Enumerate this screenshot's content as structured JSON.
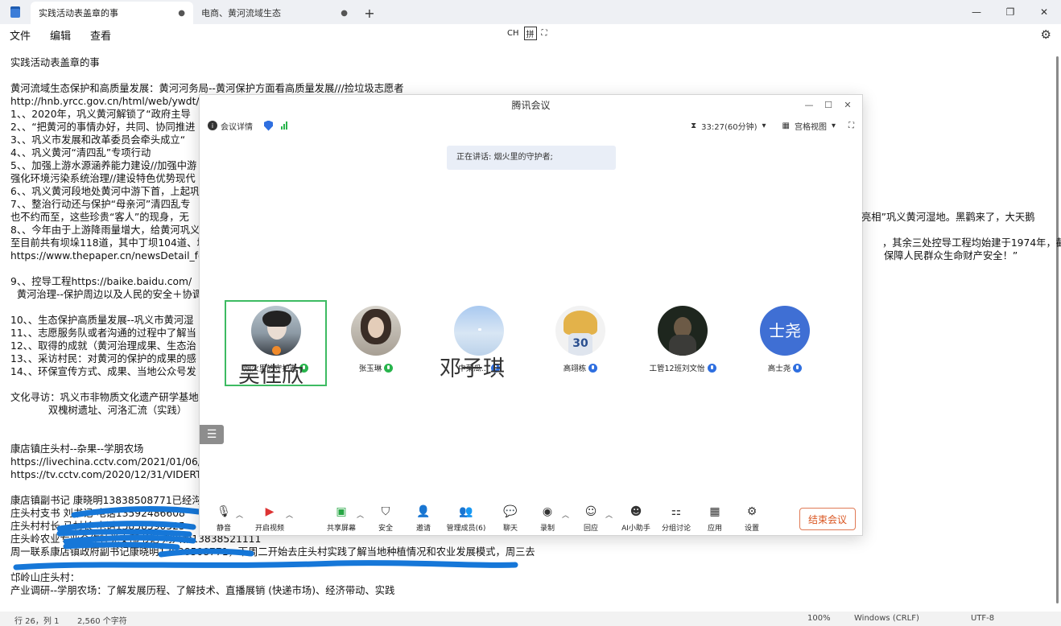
{
  "tabs": [
    {
      "label": "实践活动表盖章的事",
      "active": true
    },
    {
      "label": "电商、黄河流域生态",
      "active": false
    }
  ],
  "menu": [
    "文件",
    "编辑",
    "查看"
  ],
  "ime": {
    "ch": "CH",
    "pin": "拼"
  },
  "editor_lines": [
    "实践活动表盖章的事",
    "",
    "黄河流域生态保护和高质量发展：黄河河务局--黄河保护方面看高质量发展///捡垃圾志愿者",
    "http://hnb.yrcc.gov.cn/html/web/ywdt/",
    "1、、2020年，巩义黄河解锁了“政府主导",
    "2、、“把黄河的事情办好，共同、协同推进",
    "3、、巩义市发展和改革委员会牵头成立“",
    "4、、巩义黄河“清四乱”专项行动",
    "5、、加强上游水源涵养能力建设//加强中游",
    "强化环境污染系统治理//建设特色优势现代",
    "6、、巩义黄河段地处黄河中游下首，上起巩",
    "7、、整治行动还与保护“母亲河”清四乱专",
    "也不约而至，这些珍贵“客人”的现身，无",
    "8、、今年由于上游降雨量增大，给黄河巩义",
    "至目前共有坝垛118道，其中丁坝104道、垛",
    "https://www.thepaper.cn/newsDetail_fo",
    "",
    "9、、控导工程https://baike.baidu.com/",
    "  黄河治理--保护周边以及人民的安全＋协调",
    "",
    "10、、生态保护高质量发展--巩义市黄河湿",
    "11、、志愿服务队或者沟通的过程中了解当",
    "12、、取得的成就（黄河治理成果、生态治",
    "13、、采访村民：对黄河的保护的成果的感",
    "14、、环保宣传方式、成果、当地公众号发",
    "",
    "文化寻访：巩义市非物质文化遗产研学基地",
    "            双槐树遗址、河洛汇流（实践）",
    "",
    "",
    "康店镇庄头村--杂果--学朋农场",
    "https://livechina.cctv.com/2021/01/06/V",
    "https://tv.cctv.com/2020/12/31/VIDERT",
    "",
    "康店镇副书记 康晓明13838508771已经沟通",
    "庄头村支书 刘书记 电话13592486608",
    "庄头村村长 马村长 电话13838590525",
    "庄头岭农业专业合作社党支部书记 刘兴毅13838521111",
    "周一联系康店镇政府副书记康晓明13838508771，下周二开始去庄头村实践了解当地种植情况和农业发展模式，周三去",
    "",
    "邙岭山庄头村：",
    "产业调研--学朋农场：了解发展历程、了解技术、直播展销 (快递市场)、经济带动、实践"
  ],
  "right_fragments": [
    {
      "line": 12,
      "text": "亮相”巩义黄河湿地。黑鹳来了，大天鹅"
    },
    {
      "line": 14,
      "text": "，其余三处控导工程均始建于1974年，截"
    },
    {
      "line": 15,
      "text": "保障人民群众生命财产安全！”"
    },
    {
      "line": 39,
      "text": "周三去"
    }
  ],
  "statusbar": {
    "position": "行 26，列 1",
    "chars": "2,560 个字符",
    "zoom": "100%",
    "line_ending": "Windows (CRLF)",
    "encoding": "UTF-8"
  },
  "meeting": {
    "title": "腾讯会议",
    "info_label": "会议详情",
    "timer": "33:27(60分钟)",
    "view_label": "宫格视图",
    "speaking": "正在讲话: 烟火里的守护者;",
    "participants": [
      {
        "name": "烟火里的守护者",
        "mic": "green",
        "overlay": "吴佳欣"
      },
      {
        "name": "张玉琳",
        "mic": "green"
      },
      {
        "name": "中菜瓜...",
        "mic": "blue",
        "overlay": "邓子琪"
      },
      {
        "name": "高翊栋",
        "mic": "blue"
      },
      {
        "name": "工管12班刘文怡",
        "mic": "blue"
      },
      {
        "name": "高士尧",
        "mic": "blue",
        "initials": "士尧"
      }
    ],
    "controls": [
      {
        "label": "静音",
        "icon": "mic-icon"
      },
      {
        "label": "开启视频",
        "icon": "video-off-icon"
      },
      {
        "label": "共享屏幕",
        "icon": "share-screen-icon"
      },
      {
        "label": "安全",
        "icon": "security-icon"
      },
      {
        "label": "邀请",
        "icon": "invite-icon"
      },
      {
        "label": "管理成员(6)",
        "icon": "members-icon"
      },
      {
        "label": "聊天",
        "icon": "chat-icon"
      },
      {
        "label": "录制",
        "icon": "record-icon"
      },
      {
        "label": "回应",
        "icon": "reaction-icon"
      },
      {
        "label": "AI小助手",
        "icon": "ai-assistant-icon"
      },
      {
        "label": "分组讨论",
        "icon": "breakout-icon"
      },
      {
        "label": "应用",
        "icon": "apps-icon"
      },
      {
        "label": "设置",
        "icon": "settings-icon"
      }
    ],
    "end_label": "结束会议"
  },
  "colors": {
    "accent": "#2f6fe0",
    "speaking_border": "#3dbb62",
    "end": "#d9541f",
    "redaction": "#1677d8"
  }
}
